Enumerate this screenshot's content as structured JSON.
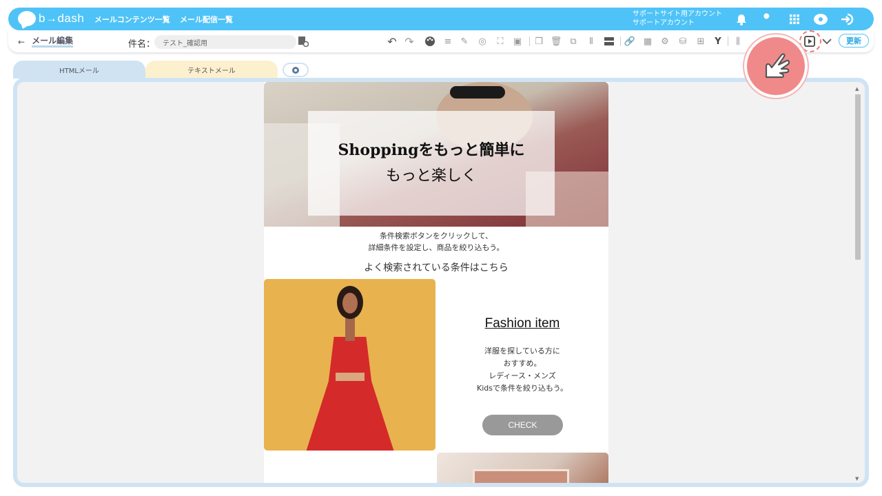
{
  "app": {
    "logo_text": "b→dash",
    "nav_links": [
      "メールコンテンツ一覧",
      "メール配信一覧"
    ],
    "account_line1": "サポートサイト用アカウント",
    "account_line2": "サポートアカウント"
  },
  "toolbar": {
    "back_label": "メール編集",
    "subject_label": "件名：",
    "subject_value": "テスト_確認用",
    "update_label": "更新"
  },
  "tabs": {
    "html": "HTMLメール",
    "text": "テキストメール"
  },
  "email": {
    "hero_line1": "Shoppingをもっと簡単に",
    "hero_line2": "もっと楽しく",
    "intro_line1": "条件検索ボタンをクリックして、",
    "intro_line2": "詳細条件を設定し、商品を絞り込もう。",
    "popular": "よく検索されている条件はこちら",
    "fashion_title": "Fashion item",
    "fashion_desc": [
      "洋服を探している方に",
      "おすすめ。",
      "レディース・メンズ",
      "Kidsで条件を絞り込もう。"
    ],
    "check_label": "CHECK"
  },
  "colors": {
    "brand": "#4fc3f7",
    "tab_html": "#cfe3f3",
    "tab_text": "#fdf0cf",
    "pointer": "#f08a8a"
  }
}
